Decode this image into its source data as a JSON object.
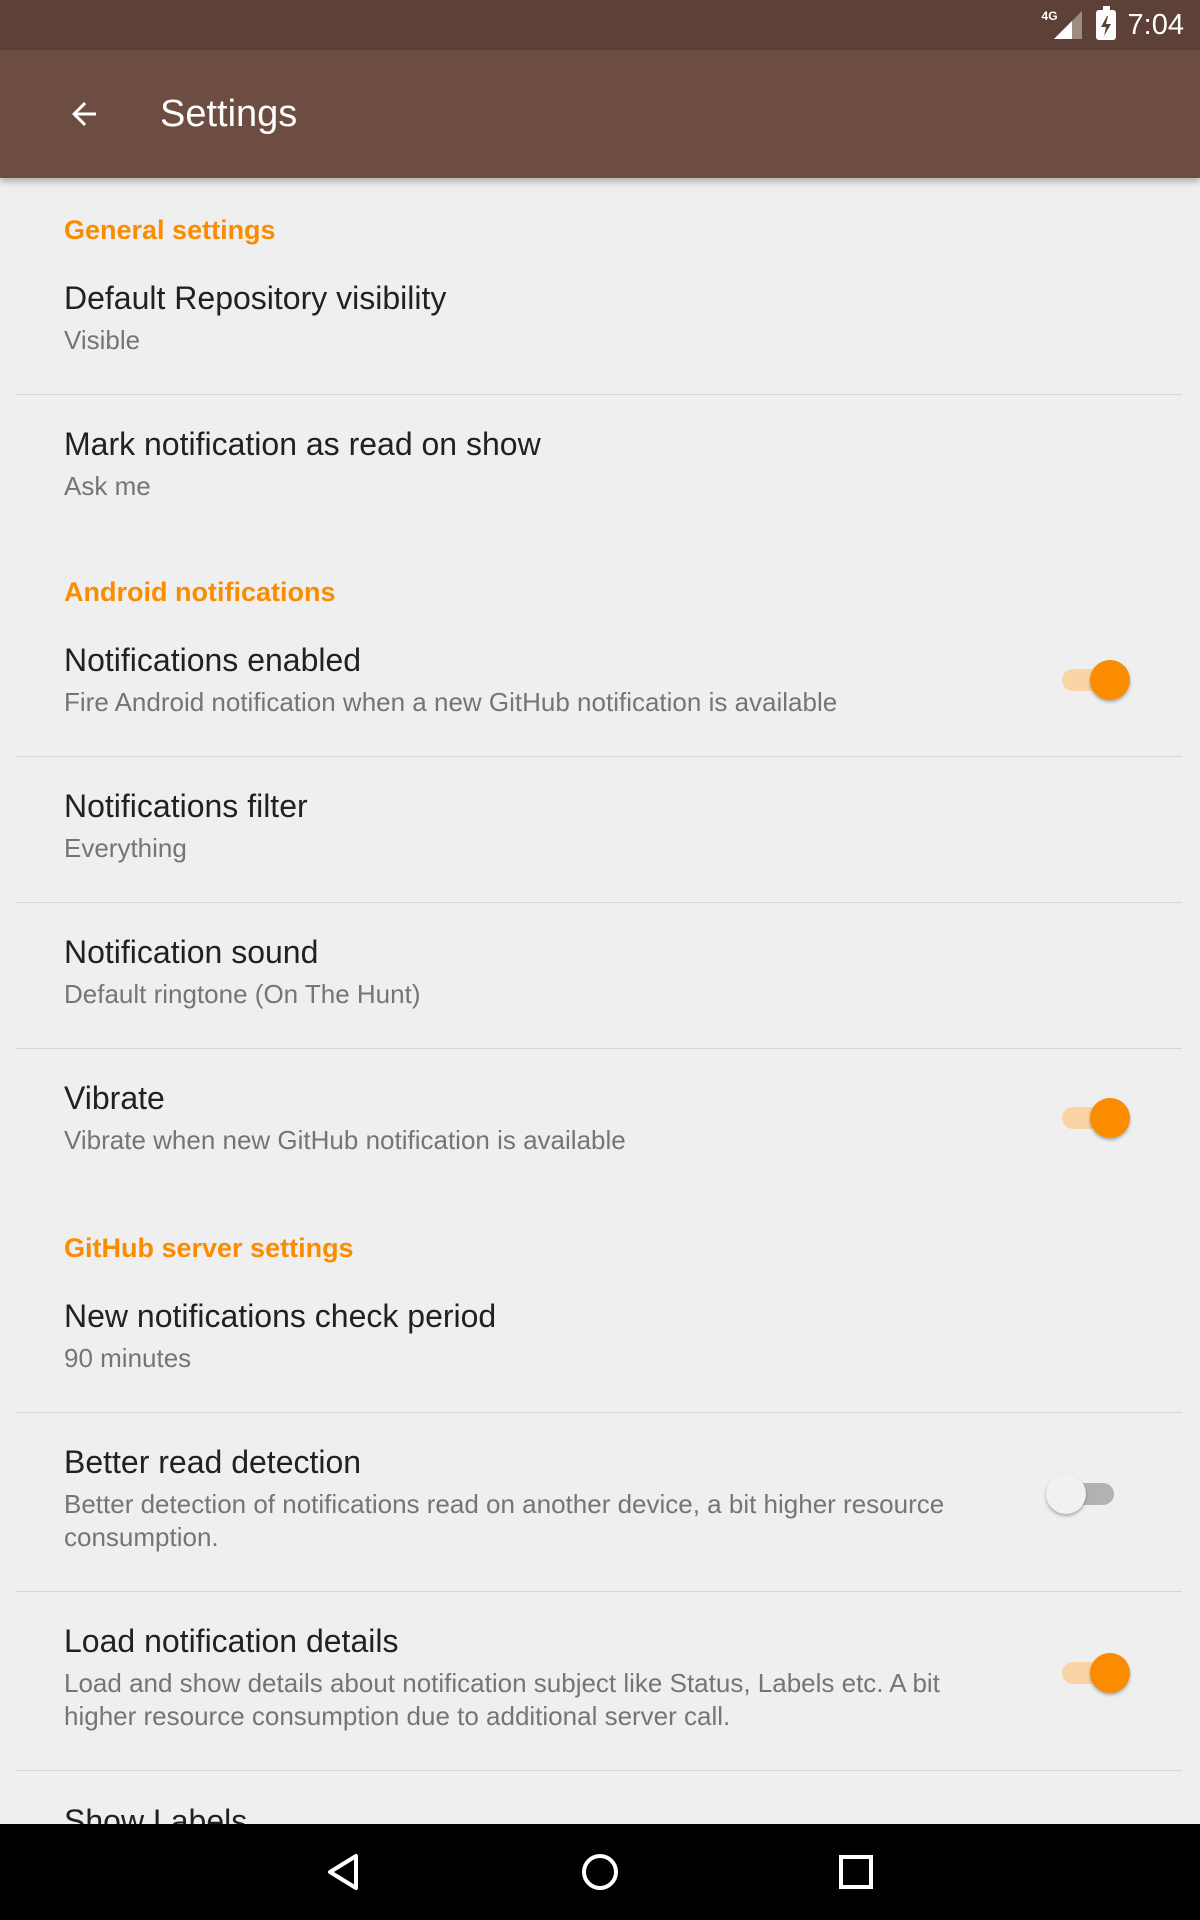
{
  "status_bar": {
    "network": "4G",
    "time": "7:04"
  },
  "app_bar": {
    "title": "Settings",
    "back_icon": "arrow-back-icon"
  },
  "sections": {
    "general": "General settings",
    "android": "Android notifications",
    "github": "GitHub server settings"
  },
  "prefs": {
    "repo_visibility": {
      "title": "Default Repository visibility",
      "summary": "Visible"
    },
    "mark_read": {
      "title": "Mark notification as read on show",
      "summary": "Ask me"
    },
    "notif_enabled": {
      "title": "Notifications enabled",
      "summary": "Fire Android notification when a new GitHub notification is available",
      "checked": true
    },
    "notif_filter": {
      "title": "Notifications filter",
      "summary": "Everything"
    },
    "notif_sound": {
      "title": "Notification sound",
      "summary": "Default ringtone (On The Hunt)"
    },
    "vibrate": {
      "title": "Vibrate",
      "summary": "Vibrate when new GitHub notification is available",
      "checked": true
    },
    "check_period": {
      "title": "New notifications check period",
      "summary": "90 minutes"
    },
    "better_read": {
      "title": "Better read detection",
      "summary": "Better detection of notifications read on another device, a bit higher resource consumption.",
      "checked": false
    },
    "load_details": {
      "title": "Load notification details",
      "summary": "Load and show details about notification subject like Status, Labels etc. A bit higher resource consumption due to additional server call.",
      "checked": true
    },
    "show_labels": {
      "title": "Show Labels"
    }
  },
  "colors": {
    "accent": "#fb8c00",
    "primary": "#6d4c41",
    "primary_dark": "#5d4037"
  },
  "nav_bar": {
    "back": "nav-back-icon",
    "home": "nav-home-icon",
    "recents": "nav-recents-icon"
  }
}
